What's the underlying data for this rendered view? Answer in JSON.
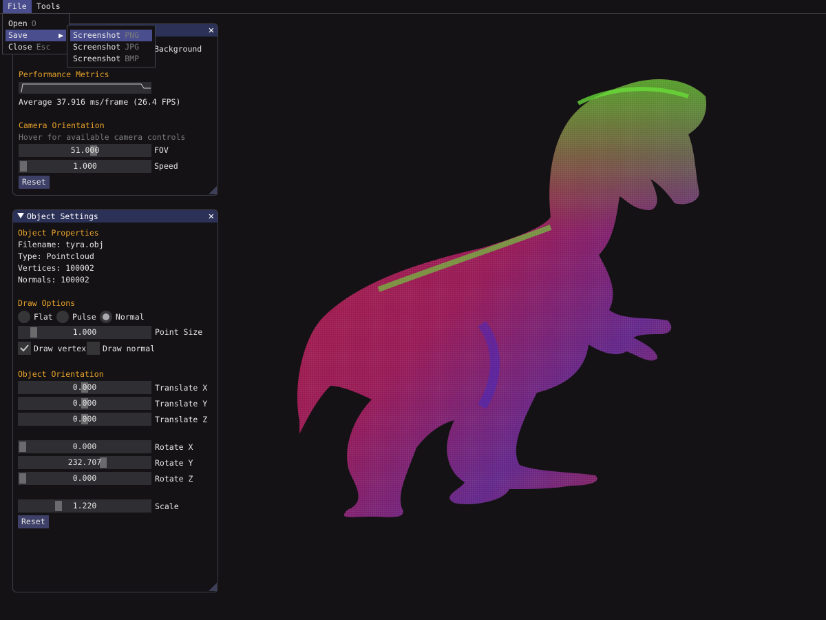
{
  "menubar": {
    "file": "File",
    "tools": "Tools"
  },
  "file_menu": {
    "items": [
      {
        "label": "Open",
        "shortcut": "O"
      },
      {
        "label": "Save",
        "shortcut": "▶"
      },
      {
        "label": "Close",
        "shortcut": "Esc"
      }
    ]
  },
  "save_submenu": {
    "items": [
      {
        "label": "Screenshot",
        "format": "PNG"
      },
      {
        "label": "Screenshot",
        "format": "JPG"
      },
      {
        "label": "Screenshot",
        "format": "BMP"
      }
    ]
  },
  "render_panel": {
    "background_label": "Background",
    "perf_header": "Performance Metrics",
    "average_text": "Average 37.916 ms/frame (26.4 FPS)",
    "cam_header": "Camera Orientation",
    "hint": "Hover for available camera controls",
    "fov": {
      "value": "51.000",
      "label": "FOV",
      "level": 0.55
    },
    "speed": {
      "value": "1.000",
      "label": "Speed",
      "level": 0.0
    },
    "reset": "Reset"
  },
  "object_panel": {
    "title": "Object Settings",
    "props_header": "Object Properties",
    "filename": "Filename: tyra.obj",
    "type": "Type: Pointcloud",
    "vertices": "Vertices: 100002",
    "normals": "Normals: 100002",
    "draw_header": "Draw Options",
    "radios": {
      "flat": "Flat",
      "pulse": "Pulse",
      "normal": "Normal",
      "selected": "Normal"
    },
    "point_size": {
      "value": "1.000",
      "label": "Point Size",
      "level": 0.1
    },
    "draw_vertex": {
      "label": "Draw vertex",
      "checked": true
    },
    "draw_normal": {
      "label": "Draw normal",
      "checked": false
    },
    "orient_header": "Object Orientation",
    "translate_x": {
      "value": "0.000",
      "label": "Translate X",
      "level": 0.5
    },
    "translate_y": {
      "value": "0.000",
      "label": "Translate Y",
      "level": 0.5
    },
    "translate_z": {
      "value": "0.000",
      "label": "Translate Z",
      "level": 0.5
    },
    "rotate_x": {
      "value": "0.000",
      "label": "Rotate X",
      "level": 0.0
    },
    "rotate_y": {
      "value": "232.707",
      "label": "Rotate Y",
      "level": 0.646
    },
    "rotate_z": {
      "value": "0.000",
      "label": "Rotate Z",
      "level": 0.0
    },
    "scale": {
      "value": "1.220",
      "label": "Scale",
      "level": 0.3
    },
    "reset": "Reset"
  },
  "colors": {
    "accent_header": "#e8a32a",
    "titlebar": "#2b3157",
    "highlight": "#4a4e8f"
  }
}
